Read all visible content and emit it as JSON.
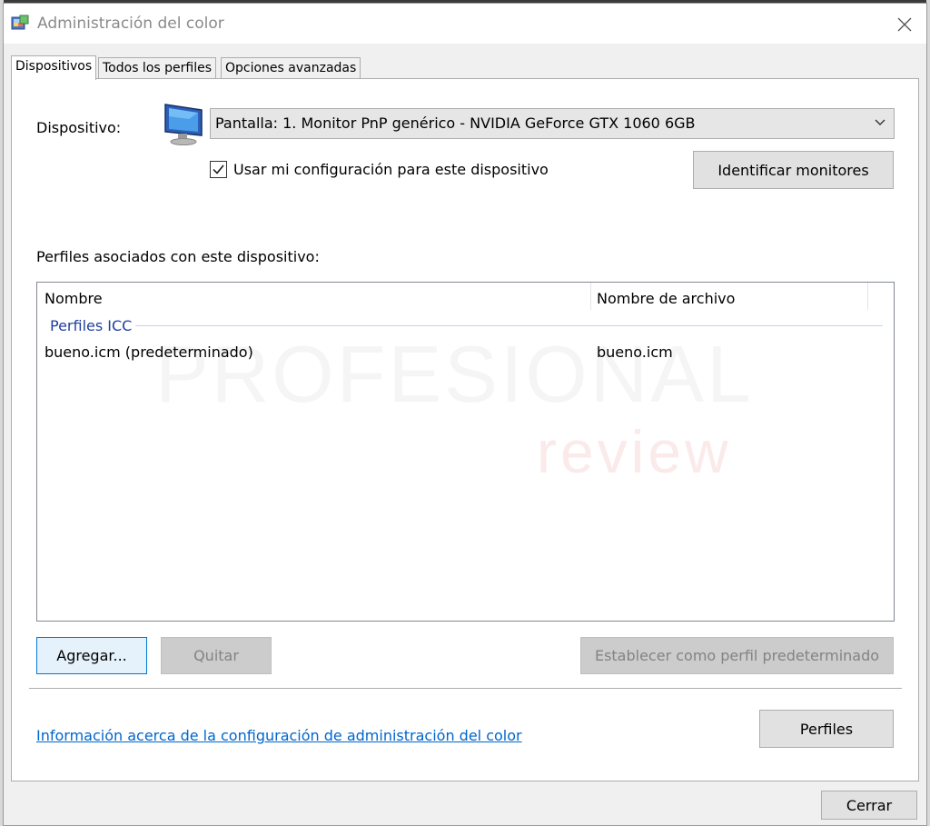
{
  "window": {
    "title": "Administración del color",
    "close_glyph": "✕"
  },
  "tabs": [
    {
      "label": "Dispositivos",
      "active": true
    },
    {
      "label": "Todos los perfiles",
      "active": false
    },
    {
      "label": "Opciones avanzadas",
      "active": false
    }
  ],
  "device": {
    "label": "Dispositivo:",
    "selected": "Pantalla: 1. Monitor PnP genérico - NVIDIA GeForce GTX 1060 6GB",
    "icon": "monitor-icon"
  },
  "use_my_settings": {
    "label": "Usar mi configuración para este dispositivo",
    "checked": true
  },
  "identify_button": "Identificar monitores",
  "profiles": {
    "label": "Perfiles asociados con este dispositivo:",
    "columns": [
      "Nombre",
      "Nombre de archivo"
    ],
    "group": "Perfiles ICC",
    "rows": [
      {
        "name": "bueno.icm (predeterminado)",
        "file": "bueno.icm"
      }
    ]
  },
  "watermark": {
    "top": "PROFESIONAL",
    "bottom": "review"
  },
  "buttons": {
    "add": "Agregar...",
    "remove": "Quitar",
    "set_default": "Establecer como perfil predeterminado",
    "profiles": "Perfiles",
    "close": "Cerrar"
  },
  "info_link": "Información acerca de la configuración de administración del color",
  "colors": {
    "accent": "#0078d7",
    "link": "#0066cc",
    "group": "#1f3fa0"
  }
}
